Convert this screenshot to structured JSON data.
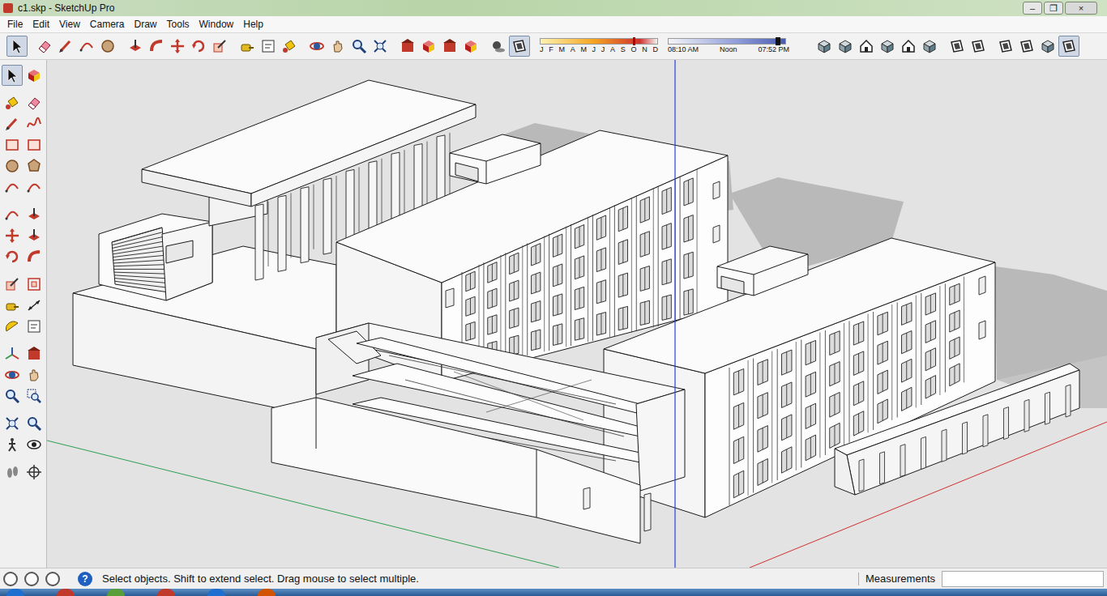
{
  "window": {
    "title": "c1.skp - SketchUp Pro",
    "controls": [
      "–",
      "❐",
      "×"
    ]
  },
  "menu": [
    "File",
    "Edit",
    "View",
    "Camera",
    "Draw",
    "Tools",
    "Window",
    "Help"
  ],
  "toolbar": {
    "tools": [
      {
        "selected": true
      },
      {
        "selected": false
      },
      {
        "selected": false
      },
      {
        "selected": false
      },
      {
        "selected": false
      },
      {
        "selected": false
      },
      {
        "selected": false
      },
      {
        "selected": false
      },
      {
        "selected": false
      },
      {
        "selected": false
      },
      {
        "selected": false
      },
      {
        "selected": false
      },
      {
        "selected": false
      },
      {
        "selected": false
      },
      {
        "selected": false
      },
      {
        "selected": false
      },
      {
        "selected": false
      },
      {
        "selected": false
      },
      {
        "selected": false
      },
      {
        "selected": false
      },
      {
        "selected": false
      },
      {
        "selected": false
      },
      {
        "selected": true
      },
      {
        "selected": false
      },
      {
        "selected": false
      },
      {
        "selected": false
      },
      {
        "selected": false
      },
      {
        "selected": false
      },
      {
        "selected": false
      },
      {
        "selected": false
      },
      {
        "selected": false
      },
      {
        "selected": false
      },
      {
        "selected": false
      },
      {
        "selected": false
      },
      {
        "selected": true
      }
    ]
  },
  "shadows": {
    "months": [
      "J",
      "F",
      "M",
      "A",
      "M",
      "J",
      "J",
      "A",
      "S",
      "O",
      "N",
      "D"
    ],
    "month_level": 0.79,
    "times": [
      "08:10 AM",
      "Noon",
      "07:52 PM"
    ],
    "time_level": 0.92
  },
  "side_toolbar": {
    "tools": [
      {
        "selected": true
      },
      {
        "selected": false
      },
      {
        "selected": false
      },
      {
        "selected": false
      },
      {
        "selected": false
      },
      {
        "selected": false
      },
      {
        "selected": false
      },
      {
        "selected": false
      },
      {
        "selected": false
      },
      {
        "selected": false
      },
      {
        "selected": false
      },
      {
        "selected": false
      },
      {
        "selected": false
      },
      {
        "selected": false
      },
      {
        "selected": false
      },
      {
        "selected": false
      },
      {
        "selected": false
      },
      {
        "selected": false
      },
      {
        "selected": false
      },
      {
        "selected": false
      },
      {
        "selected": false
      },
      {
        "selected": false
      },
      {
        "selected": false
      },
      {
        "selected": false
      },
      {
        "selected": false
      },
      {
        "selected": false
      },
      {
        "selected": false
      },
      {
        "selected": false
      },
      {
        "selected": false
      },
      {
        "selected": false
      },
      {
        "selected": false
      },
      {
        "selected": false
      },
      {
        "selected": false
      },
      {
        "selected": false
      }
    ]
  },
  "status_bar": {
    "help": "?",
    "message": "Select objects. Shift to extend select. Drag mouse to select multiple.",
    "measurements_label": "Measurements",
    "measurements_value": ""
  }
}
